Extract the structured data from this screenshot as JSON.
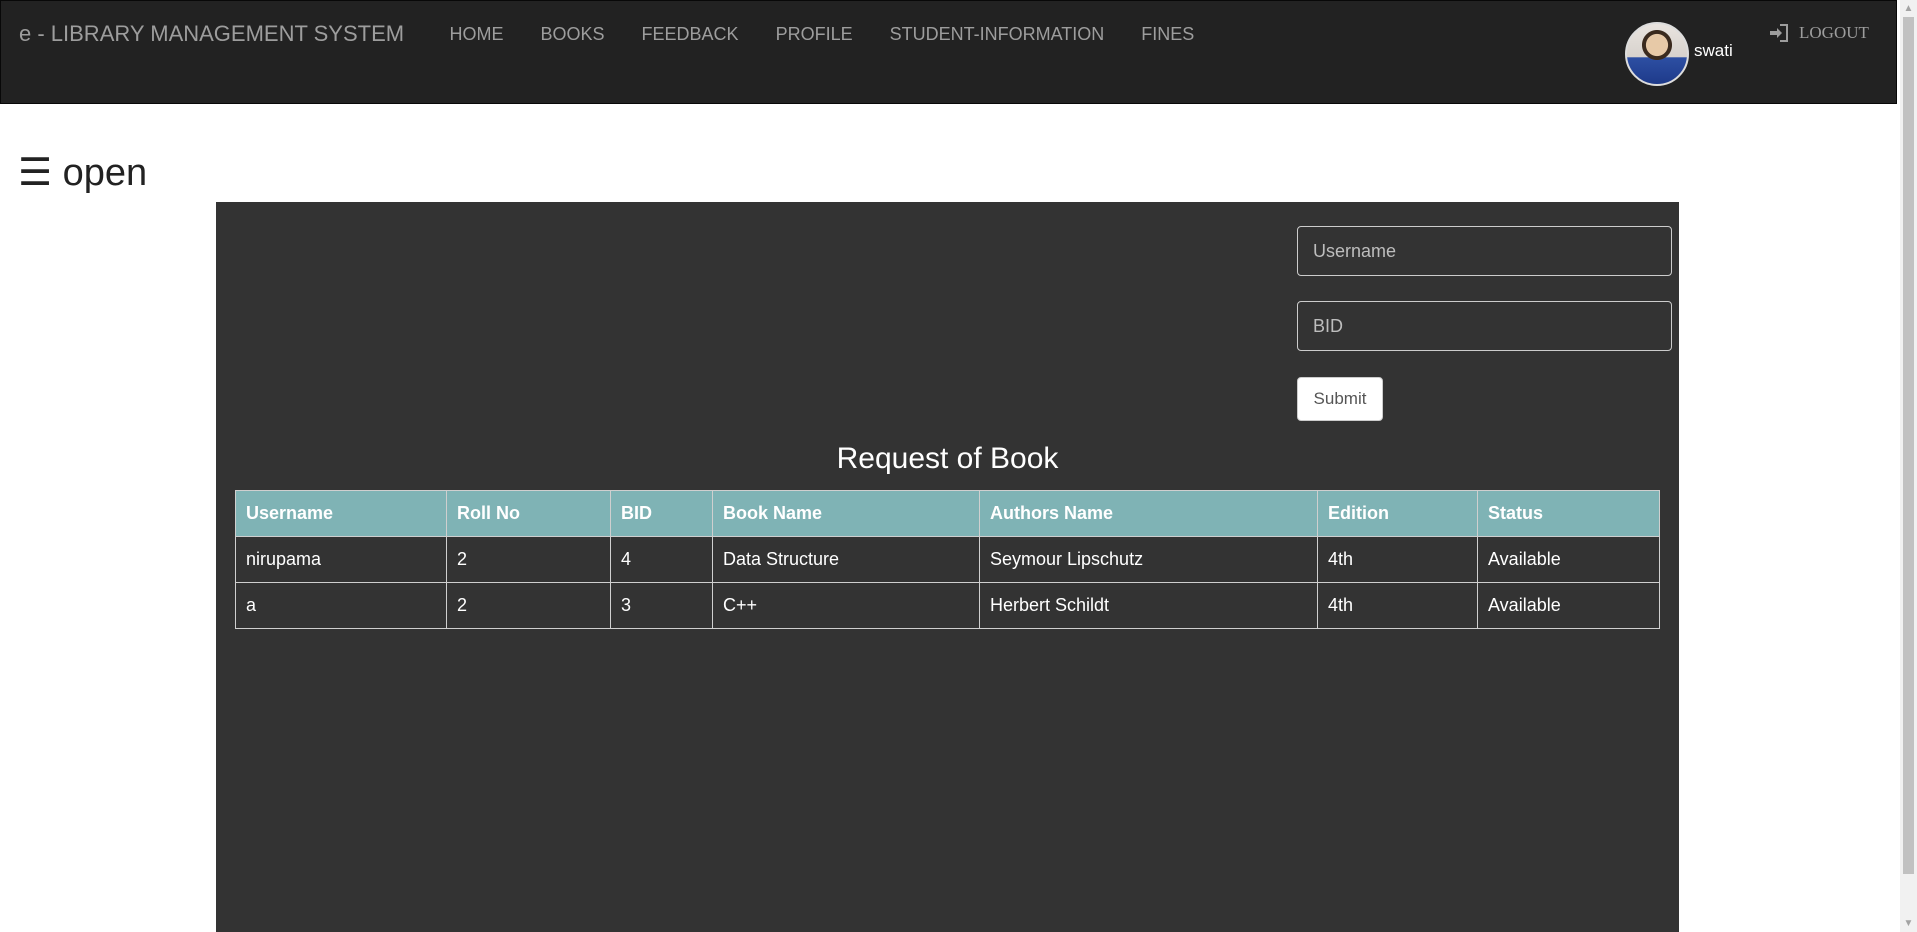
{
  "brand": "e - LIBRARY MANAGEMENT SYSTEM",
  "nav": [
    "HOME",
    "BOOKS",
    "FEEDBACK",
    "PROFILE",
    "STUDENT-INFORMATION",
    "FINES"
  ],
  "user": {
    "name": "swati"
  },
  "logout_label": "LOGOUT",
  "sidebar_toggle": "☰ open",
  "form": {
    "username_placeholder": "Username",
    "bid_placeholder": "BID",
    "submit_label": "Submit"
  },
  "table": {
    "title": "Request of Book",
    "headers": [
      "Username",
      "Roll No",
      "BID",
      "Book Name",
      "Authors Name",
      "Edition",
      "Status"
    ],
    "rows": [
      [
        "nirupama",
        "2",
        "4",
        "Data Structure",
        "Seymour Lipschutz",
        "4th",
        "Available"
      ],
      [
        "a",
        "2",
        "3",
        "C++",
        "Herbert Schildt",
        "4th",
        "Available"
      ]
    ]
  },
  "colors": {
    "navbar": "#222222",
    "panel": "#333333",
    "table_header": "#7fb3b5"
  }
}
